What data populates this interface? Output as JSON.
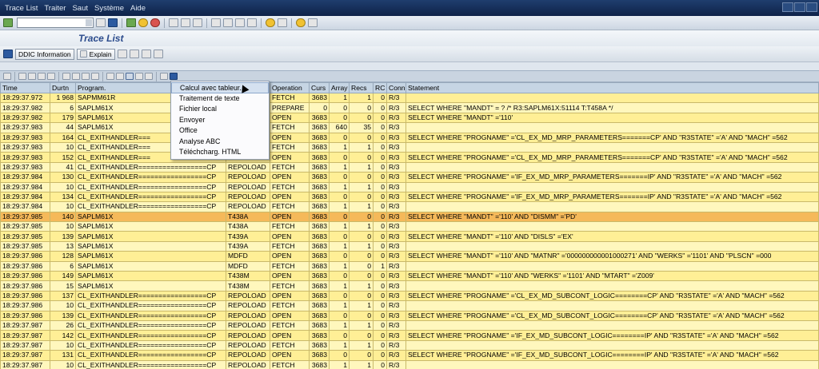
{
  "menubar": {
    "items": [
      "Trace List",
      "Traiter",
      "Saut",
      "Système",
      "Aide"
    ]
  },
  "title": "Trace List",
  "app_toolbar": {
    "ddic_label": "DDIC Information",
    "explain_label": "Explain"
  },
  "table": {
    "headers": [
      "Time",
      "Durtn",
      "Program.",
      "",
      "Operation",
      "Curs",
      "Array",
      "Recs",
      "RC",
      "Conn",
      "Statement"
    ],
    "rows": [
      [
        "18:29:37.972",
        "1 968",
        "SAPMM61R",
        "",
        "FETCH",
        "3683",
        "1",
        "1",
        "0",
        "R/3",
        ""
      ],
      [
        "18:29:37.982",
        "6",
        "SAPLM61X",
        "",
        "PREPARE",
        "0",
        "0",
        "0",
        "0",
        "R/3",
        "SELECT WHERE \"MANDT\" = ?  /* R3:SAPLM61X:51114 T:T458A */"
      ],
      [
        "18:29:37.982",
        "179",
        "SAPLM61X",
        "",
        "OPEN",
        "3683",
        "0",
        "0",
        "0",
        "R/3",
        "SELECT WHERE \"MANDT\" ='110'"
      ],
      [
        "18:29:37.983",
        "44",
        "SAPLM61X",
        "",
        "FETCH",
        "3683",
        "640",
        "35",
        "0",
        "R/3",
        ""
      ],
      [
        "18:29:37.983",
        "164",
        "CL_EXITHANDLER===",
        "",
        "OPEN",
        "3683",
        "0",
        "0",
        "0",
        "R/3",
        "SELECT WHERE \"PROGNAME\" ='CL_EX_MD_MRP_PARAMETERS=======CP' AND \"R3STATE\" ='A' AND \"MACH\" =562"
      ],
      [
        "18:29:37.983",
        "10",
        "CL_EXITHANDLER===",
        "",
        "FETCH",
        "3683",
        "1",
        "1",
        "0",
        "R/3",
        ""
      ],
      [
        "18:29:37.983",
        "152",
        "CL_EXITHANDLER===",
        "",
        "OPEN",
        "3683",
        "0",
        "0",
        "0",
        "R/3",
        "SELECT WHERE \"PROGNAME\" ='CL_EX_MD_MRP_PARAMETERS=======CP' AND \"R3STATE\" ='A' AND \"MACH\" =562"
      ],
      [
        "18:29:37.983",
        "41",
        "CL_EXITHANDLER=================CP",
        "REPOLOAD",
        "FETCH",
        "3683",
        "1",
        "1",
        "0",
        "R/3",
        ""
      ],
      [
        "18:29:37.984",
        "130",
        "CL_EXITHANDLER=================CP",
        "REPOLOAD",
        "OPEN",
        "3683",
        "0",
        "0",
        "0",
        "R/3",
        "SELECT WHERE \"PROGNAME\" ='IF_EX_MD_MRP_PARAMETERS=======IP' AND \"R3STATE\" ='A' AND \"MACH\" =562"
      ],
      [
        "18:29:37.984",
        "10",
        "CL_EXITHANDLER=================CP",
        "REPOLOAD",
        "FETCH",
        "3683",
        "1",
        "1",
        "0",
        "R/3",
        ""
      ],
      [
        "18:29:37.984",
        "134",
        "CL_EXITHANDLER=================CP",
        "REPOLOAD",
        "OPEN",
        "3683",
        "0",
        "0",
        "0",
        "R/3",
        "SELECT WHERE \"PROGNAME\" ='IF_EX_MD_MRP_PARAMETERS=======IP' AND \"R3STATE\" ='A' AND \"MACH\" =562"
      ],
      [
        "18:29:37.984",
        "10",
        "CL_EXITHANDLER=================CP",
        "REPOLOAD",
        "FETCH",
        "3683",
        "1",
        "1",
        "0",
        "R/3",
        ""
      ],
      [
        "18:29:37.985",
        "140",
        "SAPLM61X",
        "T438A",
        "OPEN",
        "3683",
        "0",
        "0",
        "0",
        "R/3",
        "SELECT WHERE \"MANDT\" ='110' AND \"DISMM\" ='PD'"
      ],
      [
        "18:29:37.985",
        "10",
        "SAPLM61X",
        "T438A",
        "FETCH",
        "3683",
        "1",
        "1",
        "0",
        "R/3",
        ""
      ],
      [
        "18:29:37.985",
        "139",
        "SAPLM61X",
        "T439A",
        "OPEN",
        "3683",
        "0",
        "0",
        "0",
        "R/3",
        "SELECT WHERE \"MANDT\" ='110' AND \"DISLS\" ='EX'"
      ],
      [
        "18:29:37.985",
        "13",
        "SAPLM61X",
        "T439A",
        "FETCH",
        "3683",
        "1",
        "1",
        "0",
        "R/3",
        ""
      ],
      [
        "18:29:37.986",
        "128",
        "SAPLM61X",
        "MDFD",
        "OPEN",
        "3683",
        "0",
        "0",
        "0",
        "R/3",
        "SELECT WHERE \"MANDT\" ='110' AND \"MATNR\" ='000000000001000271' AND \"WERKS\" ='1101' AND \"PLSCN\" =000"
      ],
      [
        "18:29:37.986",
        "6",
        "SAPLM61X",
        "MDFD",
        "FETCH",
        "3683",
        "1",
        "0",
        "1",
        "R/3",
        ""
      ],
      [
        "18:29:37.986",
        "149",
        "SAPLM61X",
        "T438M",
        "OPEN",
        "3683",
        "0",
        "0",
        "0",
        "R/3",
        "SELECT WHERE \"MANDT\" ='110' AND \"WERKS\" ='1101' AND \"MTART\" ='Z009'"
      ],
      [
        "18:29:37.986",
        "15",
        "SAPLM61X",
        "T438M",
        "FETCH",
        "3683",
        "1",
        "1",
        "0",
        "R/3",
        ""
      ],
      [
        "18:29:37.986",
        "137",
        "CL_EXITHANDLER=================CP",
        "REPOLOAD",
        "OPEN",
        "3683",
        "0",
        "0",
        "0",
        "R/3",
        "SELECT WHERE \"PROGNAME\" ='CL_EX_MD_SUBCONT_LOGIC========CP' AND \"R3STATE\" ='A' AND \"MACH\" =562"
      ],
      [
        "18:29:37.986",
        "10",
        "CL_EXITHANDLER=================CP",
        "REPOLOAD",
        "FETCH",
        "3683",
        "1",
        "1",
        "0",
        "R/3",
        ""
      ],
      [
        "18:29:37.986",
        "139",
        "CL_EXITHANDLER=================CP",
        "REPOLOAD",
        "OPEN",
        "3683",
        "0",
        "0",
        "0",
        "R/3",
        "SELECT WHERE \"PROGNAME\" ='CL_EX_MD_SUBCONT_LOGIC========CP' AND \"R3STATE\" ='A' AND \"MACH\" =562"
      ],
      [
        "18:29:37.987",
        "26",
        "CL_EXITHANDLER=================CP",
        "REPOLOAD",
        "FETCH",
        "3683",
        "1",
        "1",
        "0",
        "R/3",
        ""
      ],
      [
        "18:29:37.987",
        "142",
        "CL_EXITHANDLER=================CP",
        "REPOLOAD",
        "OPEN",
        "3683",
        "0",
        "0",
        "0",
        "R/3",
        "SELECT WHERE \"PROGNAME\" ='IF_EX_MD_SUBCONT_LOGIC========IP' AND \"R3STATE\" ='A' AND \"MACH\" =562"
      ],
      [
        "18:29:37.987",
        "10",
        "CL_EXITHANDLER=================CP",
        "REPOLOAD",
        "FETCH",
        "3683",
        "1",
        "1",
        "0",
        "R/3",
        ""
      ],
      [
        "18:29:37.987",
        "131",
        "CL_EXITHANDLER=================CP",
        "REPOLOAD",
        "OPEN",
        "3683",
        "0",
        "0",
        "0",
        "R/3",
        "SELECT WHERE \"PROGNAME\" ='IF_EX_MD_SUBCONT_LOGIC========IP' AND \"R3STATE\" ='A' AND \"MACH\" =562"
      ],
      [
        "18:29:37.987",
        "10",
        "CL_EXITHANDLER=================CP",
        "REPOLOAD",
        "FETCH",
        "3683",
        "1",
        "1",
        "0",
        "R/3",
        ""
      ]
    ],
    "selected_row": 12
  },
  "export_menu": {
    "items": [
      "Calcul avec tableur...",
      "Traitement de texte",
      "Fichier local",
      "Envoyer",
      "Office",
      "Analyse ABC",
      "Téléchcharg. HTML"
    ],
    "highlighted": 0
  }
}
